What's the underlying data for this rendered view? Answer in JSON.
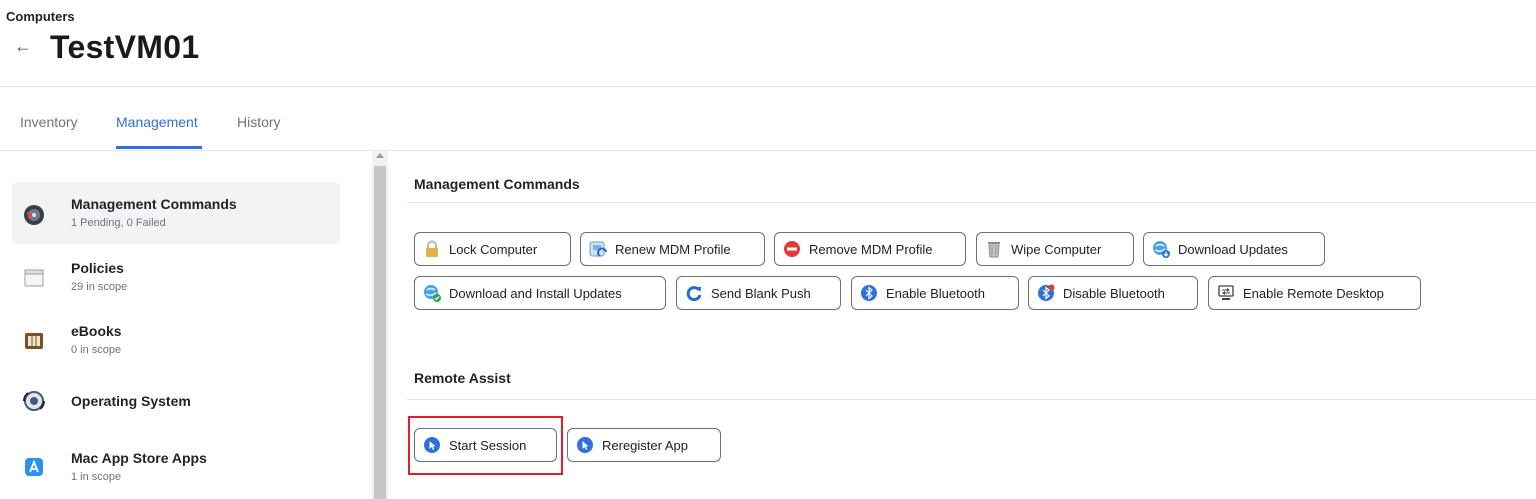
{
  "header": {
    "breadcrumb": "Computers",
    "back_icon": "arrow-left-icon",
    "title": "TestVM01"
  },
  "tabs": [
    {
      "label": "Inventory",
      "active": false
    },
    {
      "label": "Management",
      "active": true
    },
    {
      "label": "History",
      "active": false
    }
  ],
  "sidebar": {
    "items": [
      {
        "title": "Management Commands",
        "subtitle": "1 Pending, 0 Failed",
        "icon": "management-commands-icon",
        "selected": true
      },
      {
        "title": "Policies",
        "subtitle": "29 in scope",
        "icon": "policies-icon",
        "selected": false
      },
      {
        "title": "eBooks",
        "subtitle": "0 in scope",
        "icon": "ebooks-icon",
        "selected": false
      },
      {
        "title": "Operating System",
        "subtitle": "",
        "icon": "operating-system-icon",
        "selected": false
      },
      {
        "title": "Mac App Store Apps",
        "subtitle": "1 in scope",
        "icon": "app-store-icon",
        "selected": false
      }
    ]
  },
  "management_commands": {
    "title": "Management Commands",
    "buttons": [
      {
        "label": "Lock Computer",
        "icon": "lock-icon"
      },
      {
        "label": "Renew MDM Profile",
        "icon": "renew-profile-icon"
      },
      {
        "label": "Remove MDM Profile",
        "icon": "remove-icon"
      },
      {
        "label": "Wipe Computer",
        "icon": "trash-icon"
      },
      {
        "label": "Download Updates",
        "icon": "download-updates-icon"
      },
      {
        "label": "Download and Install Updates",
        "icon": "install-updates-icon"
      },
      {
        "label": "Send Blank Push",
        "icon": "refresh-icon"
      },
      {
        "label": "Enable Bluetooth",
        "icon": "bluetooth-icon"
      },
      {
        "label": "Disable Bluetooth",
        "icon": "bluetooth-disable-icon"
      },
      {
        "label": "Enable Remote Desktop",
        "icon": "remote-desktop-icon"
      }
    ]
  },
  "remote_assist": {
    "title": "Remote Assist",
    "buttons": [
      {
        "label": "Start Session",
        "icon": "cursor-icon",
        "highlighted": true
      },
      {
        "label": "Reregister App",
        "icon": "cursor-icon",
        "highlighted": false
      }
    ]
  },
  "colors": {
    "accent": "#2f6fde",
    "highlight": "#e11d2e"
  }
}
